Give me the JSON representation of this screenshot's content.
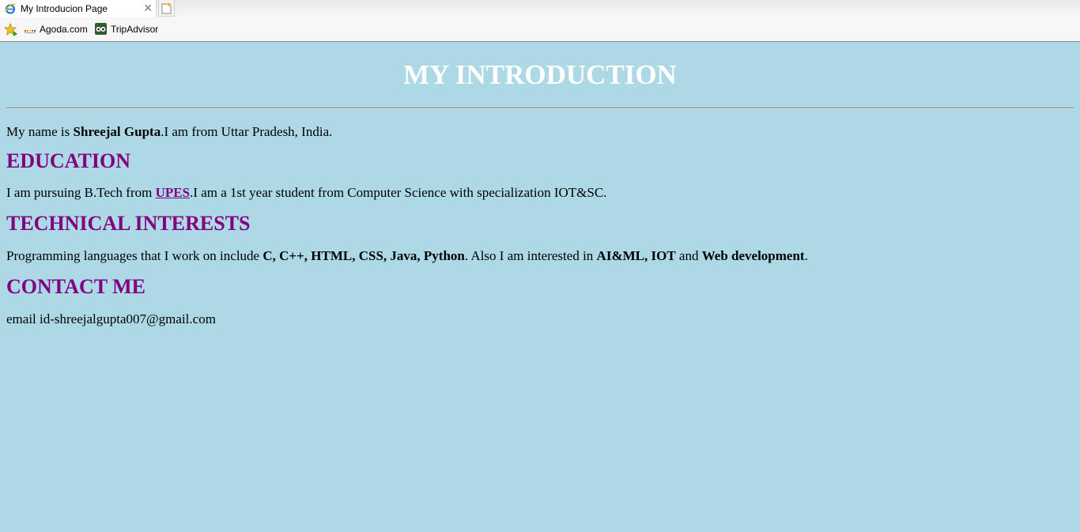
{
  "browser": {
    "tab_title": "My Introducion Page",
    "close_glyph": "✕",
    "favorites": [
      {
        "label": "Agoda.com",
        "icon": "agoda-icon"
      },
      {
        "label": "TripAdvisor",
        "icon": "tripadvisor-icon"
      }
    ]
  },
  "page": {
    "background": "#add8e6",
    "heading": "MY INTRODUCTION",
    "intro": {
      "prefix": "My name is ",
      "name": "Shreejal Gupta",
      "suffix": ".I am from Uttar Pradesh, India."
    },
    "education": {
      "heading": "EDUCATION",
      "prefix": "I am pursuing B.Tech from ",
      "link": "UPES",
      "suffix": ".I am a 1st year student from Computer Science with specialization IOT&SC."
    },
    "technical": {
      "heading": "TECHNICAL INTERESTS",
      "prefix": "Programming languages that I work on include ",
      "languages": "C, C++, HTML, CSS, Java, Python",
      "middle": ". Also I am interested in ",
      "interest1": "AI&ML, IOT",
      "and": " and ",
      "interest2": "Web development",
      "end": "."
    },
    "contact": {
      "heading": "CONTACT ME",
      "email_text": "email id-shreejalgupta007@gmail.com"
    },
    "colors": {
      "heading": "#ffffff",
      "subheading": "#800080",
      "link": "#800080"
    }
  }
}
